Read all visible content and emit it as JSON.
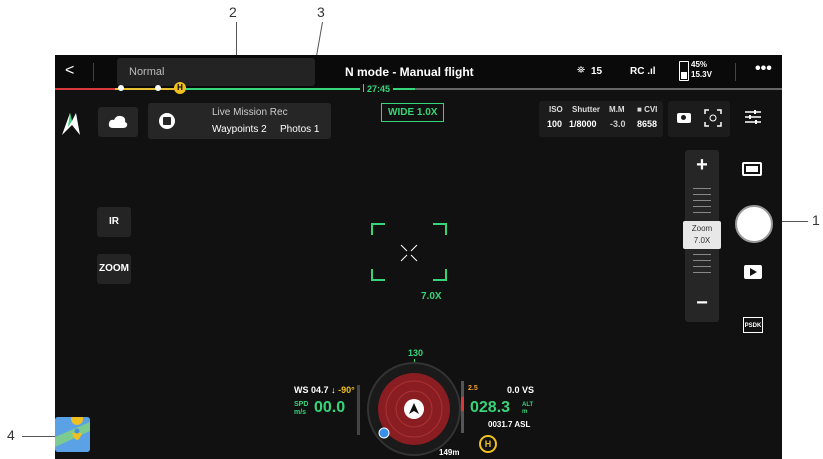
{
  "topbar": {
    "back_label": "<",
    "mode_value": "Normal",
    "title": "N mode - Manual flight",
    "satellites": "15",
    "rc_label": "RC",
    "battery_pct": "45%",
    "battery_v": "15.3V",
    "more": "•••"
  },
  "timeline": {
    "time": "27:45",
    "home_label": "H"
  },
  "mission": {
    "title": "Live Mission Rec",
    "waypoints": "Waypoints 2",
    "photos": "Photos 1"
  },
  "lens": {
    "label": "WIDE  1.0X"
  },
  "exposure": {
    "iso_label": "ISO",
    "iso_value": "100",
    "shutter_label": "Shutter",
    "shutter_value": "1/8000",
    "mm_label": "M.M",
    "mm_value": "-3.0",
    "cv_label": "CVI",
    "cv_value": "8658"
  },
  "left_buttons": {
    "ir": "IR",
    "zoom": "ZOOM"
  },
  "zoom_strip": {
    "plus": "+",
    "minus": "−",
    "label": "Zoom",
    "value": "7.0X"
  },
  "reticle": {
    "zoom": "7.0X"
  },
  "telemetry": {
    "heading": "130",
    "ws_label": "WS",
    "ws_value": "04.7",
    "ws_dir": "↓",
    "gimbal": "-90°",
    "spd_label_1": "SPD",
    "spd_label_2": "m/s",
    "speed": "00.0",
    "vs_value": "0.0",
    "vs_label": "VS",
    "vs_scale": "2.5",
    "alt_value": "028.3",
    "alt_label_1": "ALT",
    "alt_label_2": "m",
    "asl": "0031.7 ASL",
    "home_dist": "149m",
    "home_label": "H"
  },
  "psdk_label": "PSDK",
  "callouts": {
    "c1": "1",
    "c2": "2",
    "c3": "3",
    "c4": "4"
  },
  "colors": {
    "accent": "#36d57a",
    "warning": "#f0c020",
    "danger": "#d9383a"
  }
}
